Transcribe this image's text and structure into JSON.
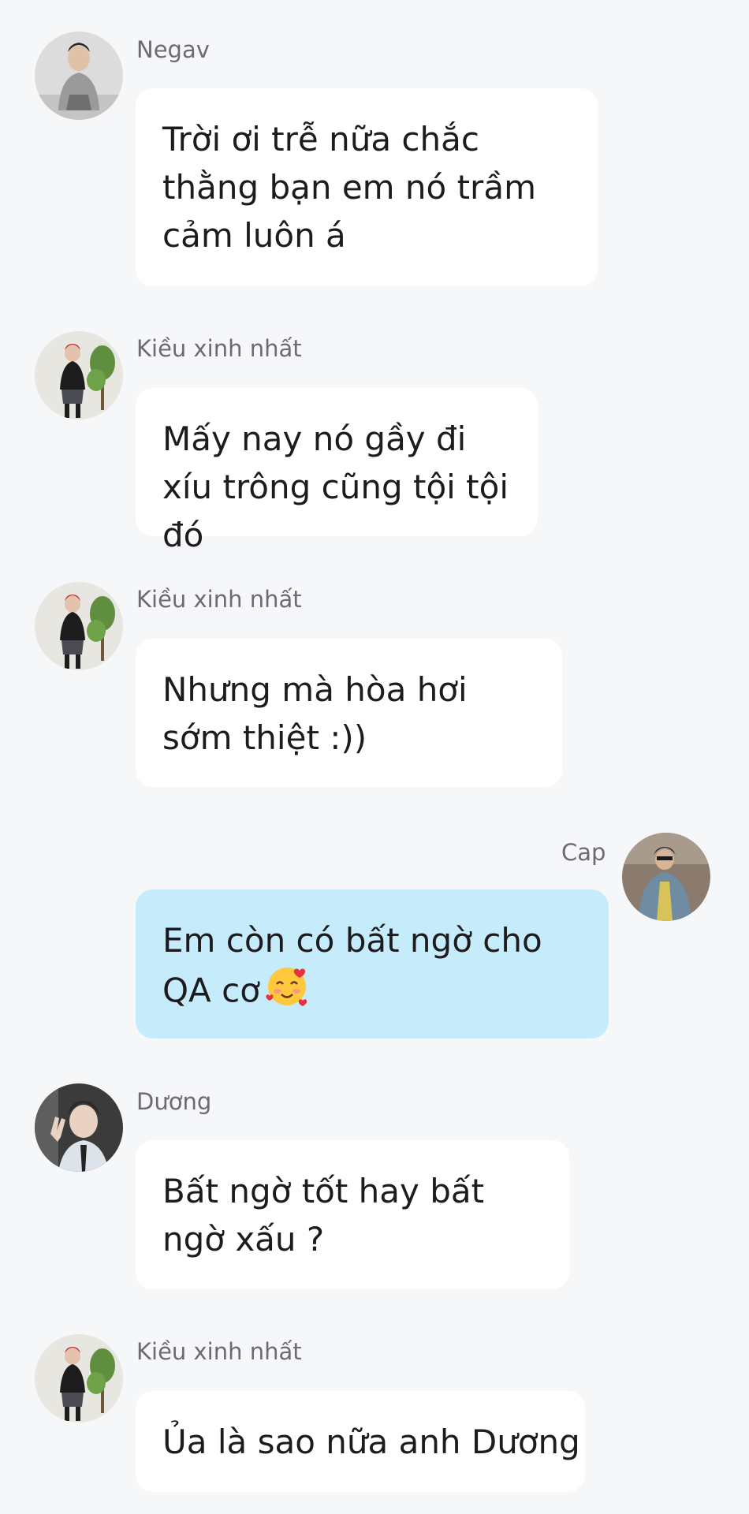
{
  "messages": [
    {
      "sender": "Negav",
      "text": "Trời ơi trễ nữa chắc thằng bạn em nó trầm cảm luôn á",
      "avatar_icon": "person-grey-sweater-avatar",
      "own": false
    },
    {
      "sender": "Kiều xinh nhất",
      "text": "Mấy nay nó gầy đi xíu trông cũng tội tội đó",
      "avatar_icon": "person-with-plant-avatar",
      "own": false
    },
    {
      "sender": "Kiều xinh nhất",
      "text": "Nhưng mà hòa hơi sớm thiệt :))",
      "avatar_icon": "person-with-plant-avatar",
      "own": false
    },
    {
      "sender": "Cap",
      "text": "Em còn có bất ngờ cho QA cơ",
      "emoji": "🥰",
      "avatar_icon": "person-denim-jacket-avatar",
      "own": true
    },
    {
      "sender": "Dương",
      "text": "Bất ngờ tốt hay bất ngờ xấu ?",
      "avatar_icon": "person-peace-sign-avatar",
      "own": false
    },
    {
      "sender": "Kiều xinh nhất",
      "text": "Ủa là sao nữa anh Dương",
      "avatar_icon": "person-with-plant-avatar",
      "own": false
    }
  ],
  "colors": {
    "background": "#f6f7f9",
    "bubble_other": "#ffffff",
    "bubble_own": "#c6ecfc",
    "name_text": "#6b6b70"
  }
}
